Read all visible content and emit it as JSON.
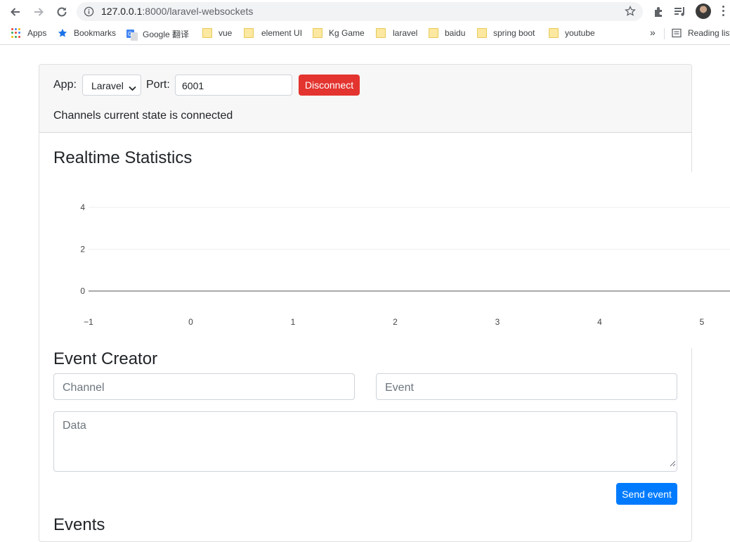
{
  "browser": {
    "url_host": "127.0.0.1",
    "url_path": ":8000/laravel-websockets",
    "bookmarks": [
      {
        "label": "Apps",
        "icon": "apps-grid-icon"
      },
      {
        "label": "Bookmarks",
        "icon": "star-icon"
      },
      {
        "label": "Google 翻译",
        "icon": "google-translate-icon"
      },
      {
        "label": "vue",
        "icon": "folder-icon"
      },
      {
        "label": "element UI",
        "icon": "folder-icon"
      },
      {
        "label": "Kg Game",
        "icon": "folder-icon"
      },
      {
        "label": "laravel",
        "icon": "folder-icon"
      },
      {
        "label": "baidu",
        "icon": "folder-icon"
      },
      {
        "label": "spring boot",
        "icon": "folder-icon"
      },
      {
        "label": "youtube",
        "icon": "folder-icon"
      }
    ],
    "overflow_label": "»",
    "reading_list_label": "Reading list"
  },
  "header": {
    "app_label": "App:",
    "app_selected": "Laravel",
    "port_label": "Port:",
    "port_value": "6001",
    "disconnect_label": "Disconnect",
    "state_text": "Channels current state is connected"
  },
  "stats": {
    "title": "Realtime Statistics"
  },
  "chart_data": {
    "type": "line",
    "title": "",
    "xlabel": "",
    "ylabel": "",
    "x_ticks": [
      "−1",
      "0",
      "1",
      "2",
      "3",
      "4",
      "5"
    ],
    "y_ticks": [
      "0",
      "2",
      "4"
    ],
    "xlim": [
      -1,
      5
    ],
    "ylim": [
      0,
      4
    ],
    "series": [],
    "grid": true
  },
  "creator": {
    "title": "Event Creator",
    "channel_placeholder": "Channel",
    "event_placeholder": "Event",
    "data_placeholder": "Data",
    "send_label": "Send event"
  },
  "events": {
    "title": "Events"
  },
  "colors": {
    "danger": "#e3342f",
    "primary": "#007bff",
    "card_header_bg": "#f7f7f7"
  }
}
